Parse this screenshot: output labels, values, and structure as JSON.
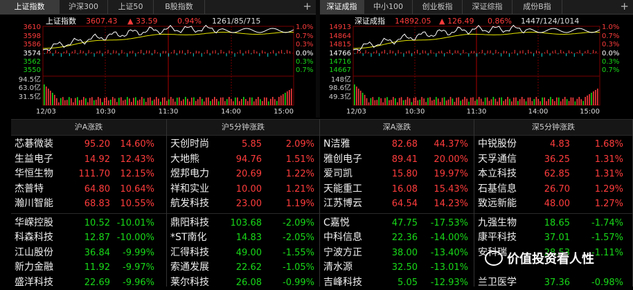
{
  "left_panel": {
    "tabs": [
      {
        "label": "上证指数",
        "active": true
      },
      {
        "label": "沪深300",
        "active": false
      },
      {
        "label": "上证50",
        "active": false
      },
      {
        "label": "B股指数",
        "active": false
      }
    ],
    "plus": "+",
    "index_name": "上证指数",
    "index_value": "3607.43",
    "change": "▲ 33.59",
    "change_pct": "0.94%",
    "breadth": "1261/85/715",
    "y_left": [
      "3610",
      "3598",
      "3586",
      "3574",
      "3562",
      "3550"
    ],
    "y_right": [
      "1.0%",
      "0.7%",
      "0.3%",
      "0.0%",
      "0.3%",
      "0.7%"
    ],
    "vol_left": [
      "94.5亿",
      "63.0亿",
      "31.5亿"
    ],
    "x_ticks": [
      "12/03",
      "10:30",
      "11:30",
      "14:00",
      "15:00"
    ]
  },
  "right_panel": {
    "tabs": [
      {
        "label": "深证成指",
        "active": true
      },
      {
        "label": "中小100",
        "active": false
      },
      {
        "label": "创业板指",
        "active": false
      },
      {
        "label": "深证综指",
        "active": false
      },
      {
        "label": "成份B指",
        "active": false
      }
    ],
    "plus": "+",
    "index_name": "深证成指",
    "index_value": "14892.05",
    "change": "▲ 126.49",
    "change_pct": "0.86%",
    "breadth": "1447/124/1014",
    "y_left": [
      "14913",
      "14864",
      "14815",
      "14766",
      "14716",
      "14667"
    ],
    "y_right": [
      "1.0%",
      "0.7%",
      "0.3%",
      "0.0%",
      "0.3%",
      "0.7%"
    ],
    "vol_left": [
      "148亿",
      "98.6亿",
      "49.3亿"
    ],
    "x_ticks": [
      "12/03",
      "10:30",
      "11:30",
      "14:00",
      "15:00"
    ]
  },
  "tables": [
    {
      "title": "沪A涨跌",
      "rows": [
        {
          "name": "芯碁微装",
          "price": "95.20",
          "pct": "14.60%",
          "dir": "up"
        },
        {
          "name": "生益电子",
          "price": "14.92",
          "pct": "12.43%",
          "dir": "up"
        },
        {
          "name": "华恒生物",
          "price": "111.70",
          "pct": "12.15%",
          "dir": "up"
        },
        {
          "name": "杰普特",
          "price": "64.80",
          "pct": "10.64%",
          "dir": "up"
        },
        {
          "name": "瀚川智能",
          "price": "68.83",
          "pct": "10.55%",
          "dir": "up"
        },
        {
          "name": "华嵘控股",
          "price": "10.52",
          "pct": "-10.01%",
          "dir": "down"
        },
        {
          "name": "科森科技",
          "price": "12.87",
          "pct": "-10.00%",
          "dir": "down"
        },
        {
          "name": "江山股份",
          "price": "36.84",
          "pct": "-9.99%",
          "dir": "down"
        },
        {
          "name": "新力金融",
          "price": "11.92",
          "pct": "-9.97%",
          "dir": "down"
        },
        {
          "name": "盛洋科技",
          "price": "22.69",
          "pct": "-9.96%",
          "dir": "down"
        }
      ]
    },
    {
      "title": "沪5分钟涨跌",
      "rows": [
        {
          "name": "天创时尚",
          "price": "5.85",
          "pct": "2.09%",
          "dir": "up"
        },
        {
          "name": "大地熊",
          "price": "94.76",
          "pct": "1.51%",
          "dir": "up"
        },
        {
          "name": "煜邦电力",
          "price": "20.69",
          "pct": "1.22%",
          "dir": "up"
        },
        {
          "name": "祥和实业",
          "price": "10.00",
          "pct": "1.21%",
          "dir": "up"
        },
        {
          "name": "航发科技",
          "price": "23.00",
          "pct": "1.19%",
          "dir": "up"
        },
        {
          "name": "鼎阳科技",
          "price": "103.68",
          "pct": "-2.09%",
          "dir": "down"
        },
        {
          "name": "*ST南化",
          "price": "14.83",
          "pct": "-2.05%",
          "dir": "down"
        },
        {
          "name": "汇得科技",
          "price": "49.00",
          "pct": "-1.55%",
          "dir": "down"
        },
        {
          "name": "索通发展",
          "price": "22.62",
          "pct": "-1.05%",
          "dir": "down"
        },
        {
          "name": "莱尔科技",
          "price": "26.08",
          "pct": "-0.99%",
          "dir": "down"
        }
      ]
    },
    {
      "title": "深A涨跌",
      "rows": [
        {
          "name": "N洁雅",
          "price": "82.68",
          "pct": "44.37%",
          "dir": "up"
        },
        {
          "name": "雅创电子",
          "price": "89.41",
          "pct": "20.00%",
          "dir": "up"
        },
        {
          "name": "爱司凯",
          "price": "15.80",
          "pct": "19.97%",
          "dir": "up"
        },
        {
          "name": "天能重工",
          "price": "16.08",
          "pct": "15.43%",
          "dir": "up"
        },
        {
          "name": "江苏博云",
          "price": "64.54",
          "pct": "14.23%",
          "dir": "up"
        },
        {
          "name": "C嘉悦",
          "price": "47.75",
          "pct": "-17.53%",
          "dir": "down"
        },
        {
          "name": "中科信息",
          "price": "22.36",
          "pct": "-14.00%",
          "dir": "down"
        },
        {
          "name": "宁波方正",
          "price": "38.00",
          "pct": "-13.40%",
          "dir": "down"
        },
        {
          "name": "清水源",
          "price": "32.50",
          "pct": "-13.01%",
          "dir": "down"
        },
        {
          "name": "吉峰科技",
          "price": "5.05",
          "pct": "-12.93%",
          "dir": "down"
        }
      ]
    },
    {
      "title": "深5分钟涨跌",
      "rows": [
        {
          "name": "中锐股份",
          "price": "4.83",
          "pct": "1.68%",
          "dir": "up"
        },
        {
          "name": "天孚通信",
          "price": "36.25",
          "pct": "1.31%",
          "dir": "up"
        },
        {
          "name": "本立科技",
          "price": "62.85",
          "pct": "1.31%",
          "dir": "up"
        },
        {
          "name": "石基信息",
          "price": "26.70",
          "pct": "1.29%",
          "dir": "up"
        },
        {
          "name": "致远新能",
          "price": "48.00",
          "pct": "1.27%",
          "dir": "up"
        },
        {
          "name": "九强生物",
          "price": "18.65",
          "pct": "-1.74%",
          "dir": "down"
        },
        {
          "name": "康平科技",
          "price": "37.01",
          "pct": "-1.57%",
          "dir": "down"
        },
        {
          "name": "安科瑞",
          "price": "28.53",
          "pct": "-1.11%",
          "dir": "down"
        },
        {
          "name": "",
          "price": "",
          "pct": "",
          "dir": "down"
        },
        {
          "name": "兰卫医学",
          "price": "37.36",
          "pct": "-0.98%",
          "dir": "down"
        }
      ]
    }
  ],
  "watermark": "价值投资看人性",
  "colors": {
    "up": "#ff3c3c",
    "down": "#18d818",
    "price_line": "#ffffff",
    "avg_line": "#e6e600"
  }
}
